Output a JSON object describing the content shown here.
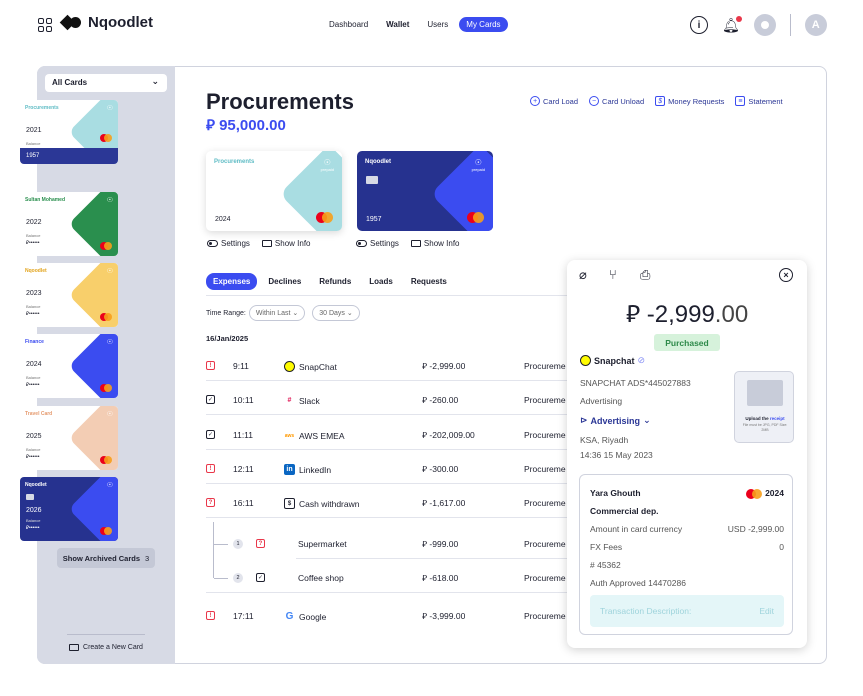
{
  "brand": "Nqoodlet",
  "nav": {
    "dashboard": "Dashboard",
    "wallet": "Wallet",
    "users": "Users",
    "mycards": "My Cards"
  },
  "header": {
    "info_icon": "i",
    "avatar_initial": "A"
  },
  "sidebar": {
    "filter": "All Cards",
    "cards": [
      {
        "name": "Procurements",
        "year": "2021",
        "balance": "Balance",
        "stars": "⃁••••••",
        "last4": "1957",
        "name_color": "#5fbcc5"
      },
      {
        "name": "Sultan Mohamed",
        "year": "2022",
        "balance": "Balance",
        "stars": "⃁••••••",
        "name_color": "#2a8f4e"
      },
      {
        "name": "Nqoodlet",
        "year": "2023",
        "balance": "Balance",
        "stars": "⃁••••••",
        "name_color": "#e2a31b"
      },
      {
        "name": "Finance",
        "year": "2024",
        "balance": "Balance",
        "stars": "⃁••••••",
        "name_color": "#3b4cf0"
      },
      {
        "name": "Travel Card",
        "year": "2025",
        "balance": "Balance",
        "stars": "⃁••••••",
        "name_color": "#e59a6e"
      },
      {
        "name": "Nqoodlet",
        "year": "2026",
        "balance": "Balance",
        "stars": "⃁••••••",
        "name_color": "#ffffff"
      }
    ],
    "archived_label": "Show Archived Cards",
    "archived_count": "3",
    "create_label": "Create a New Card",
    "prepaid": "prepaid"
  },
  "main": {
    "title": "Procurements",
    "amount": "⃁ 95,000.00",
    "actions": {
      "load": "Card Load",
      "unload": "Card Unload",
      "money": "Money Requests",
      "statement": "Statement"
    },
    "card1": {
      "name": "Procurements",
      "year": "2024",
      "prepaid": "prepaid",
      "settings": "Settings",
      "info": "Show Info"
    },
    "card2": {
      "name": "Nqoodlet",
      "year": "1957",
      "prepaid": "prepaid",
      "settings": "Settings",
      "info": "Show Info"
    },
    "tabs": [
      "Expenses",
      "Declines",
      "Refunds",
      "Loads",
      "Requests"
    ],
    "range_label": "Time Range:",
    "range_select": "Within Last",
    "range_value": "30 Days",
    "date": "16/Jan/2025",
    "rows": [
      {
        "status": "!",
        "time": "9:11",
        "merchant": "SnapChat",
        "amount": "⃁ -2,999.00",
        "category": "Procureme"
      },
      {
        "status": "✓",
        "time": "10:11",
        "merchant": "Slack",
        "amount": "⃁ -260.00",
        "category": "Procureme"
      },
      {
        "status": "✓",
        "time": "11:11",
        "merchant": "AWS EMEA",
        "amount": "⃁ -202,009.00",
        "category": "Procureme"
      },
      {
        "status": "!",
        "time": "12:11",
        "merchant": "LinkedIn",
        "amount": "⃁ -300.00",
        "category": "Procureme"
      },
      {
        "status": "?",
        "time": "16:11",
        "merchant": "Cash withdrawn",
        "amount": "⃁ -1,617.00",
        "category": "Procureme"
      },
      {
        "num": "1",
        "status": "?",
        "merchant": "Supermarket",
        "amount": "⃁ -999.00",
        "category": "Procureme"
      },
      {
        "num": "2",
        "status": "✓",
        "merchant": "Coffee shop",
        "amount": "⃁ -618.00",
        "category": "Procureme"
      },
      {
        "status": "!",
        "time": "17:11",
        "merchant": "Google",
        "amount": "⃁ -3,999.00",
        "category": "Procureme"
      }
    ]
  },
  "panel": {
    "amount_prefix": "⃁ -2,999",
    "amount_decimals": ".00",
    "status": "Purchased",
    "merchant": "Snapchat",
    "descriptor": "SNAPCHAT ADS*445027883",
    "tag": "Advertising",
    "category": "Advertising",
    "location": "KSA, Riyadh",
    "datetime": "14:36  15 May 2023",
    "receipt_title": "Upload the",
    "receipt_link": "receipt",
    "receipt_note": "File must be JPG, PDF Size: 2MB",
    "holder": "Yara Ghouth",
    "card_year": "2024",
    "department": "Commercial dep.",
    "amount_in_currency_label": "Amount in card currency",
    "amount_in_currency_value": "USD -2,999.00",
    "fx_label": "FX Fees",
    "fx_value": "0",
    "ref": "# 45362",
    "auth": "Auth Approved 14470286",
    "desc_placeholder": "Transaction Description:",
    "edit": "Edit"
  }
}
